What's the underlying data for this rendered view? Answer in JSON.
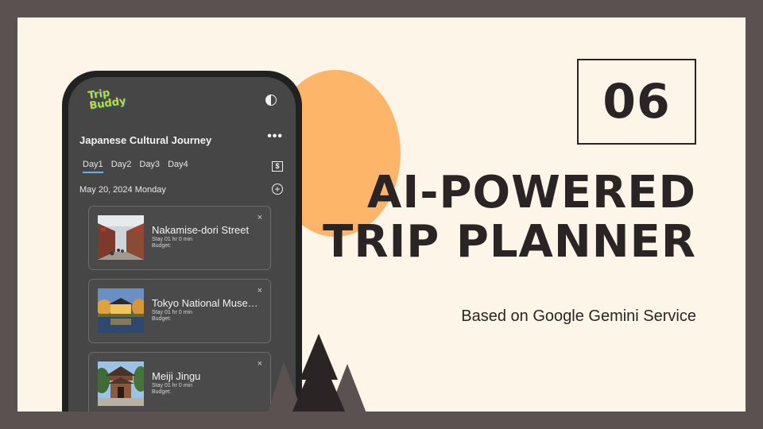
{
  "slide": {
    "number": "06",
    "headline_line1": "AI-POWERED",
    "headline_line2": "TRIP PLANNER",
    "subtitle": "Based on Google Gemini Service"
  },
  "app": {
    "logo_line1": "Trip",
    "logo_line2": "Buddy",
    "trip_title": "Japanese Cultural Journey",
    "more_label": "•••",
    "tabs": [
      "Day1",
      "Day2",
      "Day3",
      "Day4"
    ],
    "active_tab": "Day1",
    "budget_icon_glyph": "$",
    "date": "May 20, 2024 Monday",
    "add_glyph": "+",
    "places": [
      {
        "name": "Nakamise-dori Street",
        "stay": "Stay 01 hr 0 min",
        "budget": "Budget:"
      },
      {
        "name": "Tokyo National Museum",
        "stay": "Stay 01 hr 0 min",
        "budget": "Budget:"
      },
      {
        "name": "Meiji Jingu",
        "stay": "Stay 01 hr 0 min",
        "budget": "Budget:"
      }
    ],
    "close_glyph": "×"
  },
  "colors": {
    "frame": "#5a5150",
    "background": "#fdf6e8",
    "sun": "#fdb56a",
    "text_dark": "#2b2424",
    "phone_screen": "#464646",
    "tab_underline": "#63b3ed"
  }
}
